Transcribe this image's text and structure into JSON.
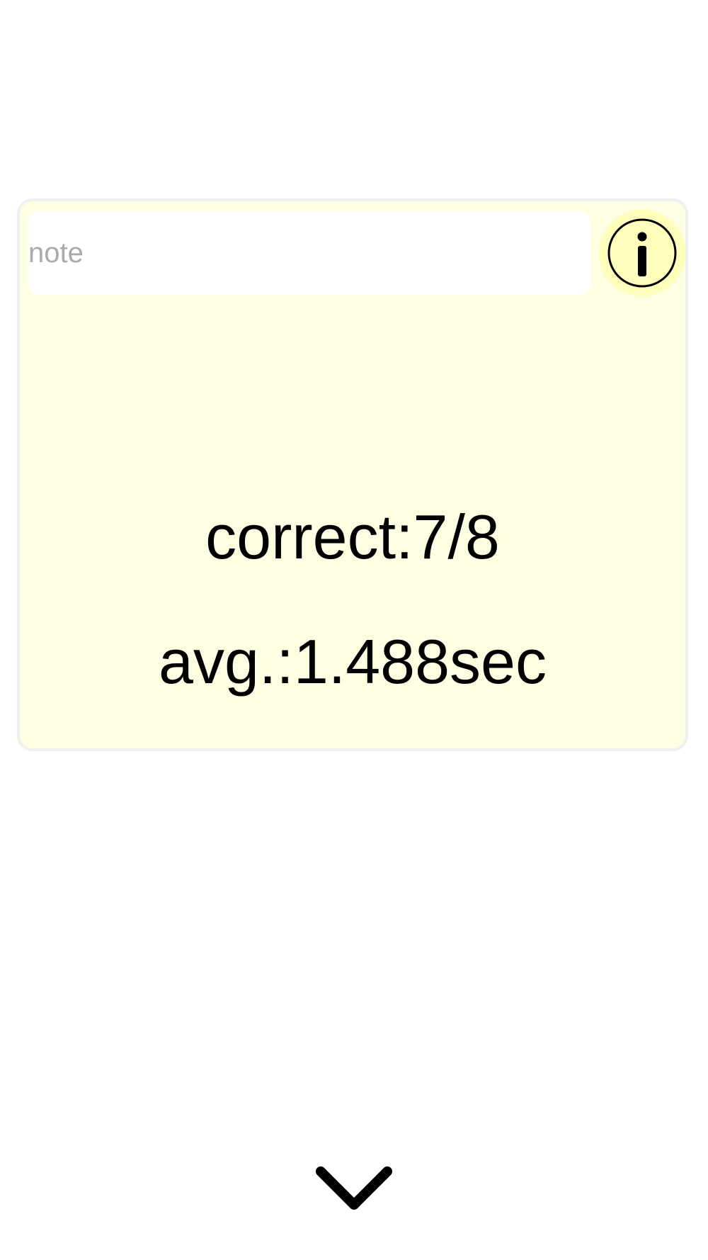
{
  "note": {
    "value": "",
    "placeholder": "note"
  },
  "info_button": {
    "icon": "info-icon"
  },
  "stats": {
    "correct": "correct:7/8",
    "avg": "avg.:1.488sec"
  },
  "expand_button": {
    "icon": "chevron-down-icon"
  },
  "colors": {
    "card_background": "#fefee3",
    "card_border": "#efefef",
    "info_button_background": "#ffffbb",
    "placeholder_text": "#aaaaaa"
  }
}
